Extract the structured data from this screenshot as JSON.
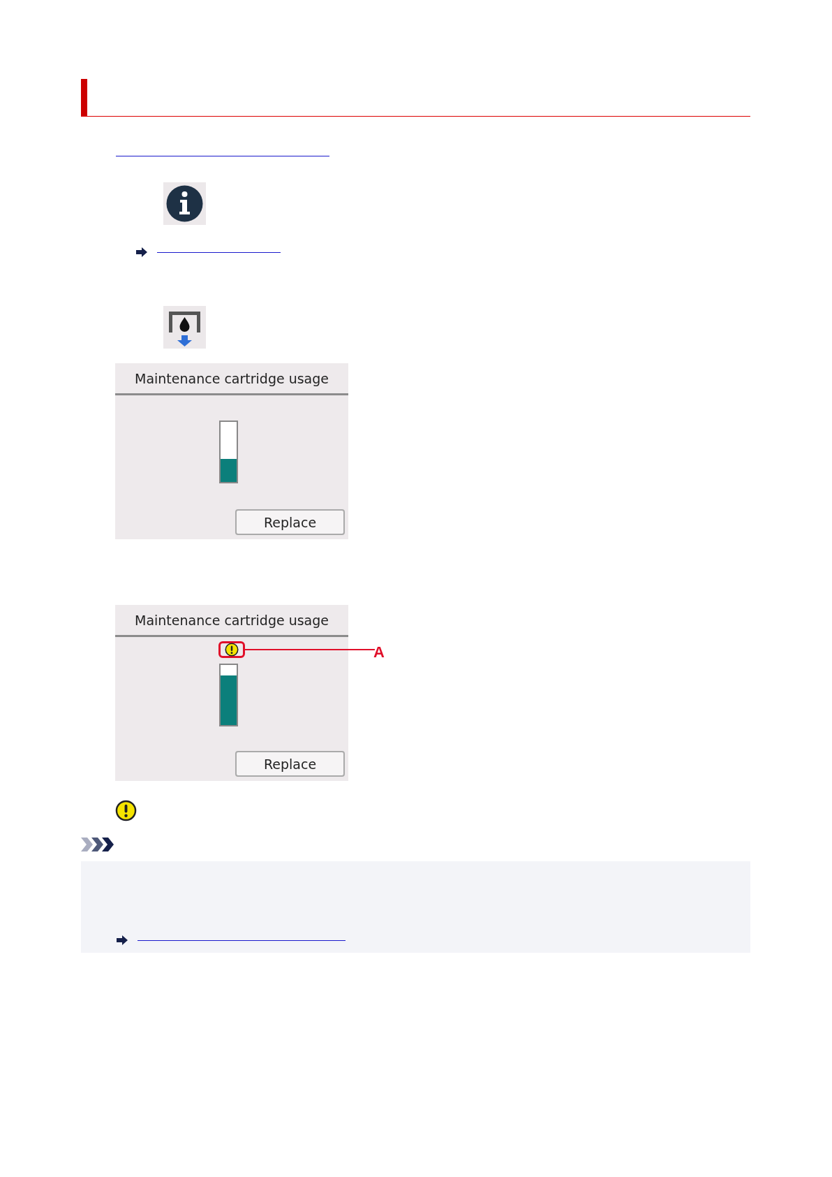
{
  "panels": [
    {
      "title": "Maintenance cartridge usage",
      "level": 0.38,
      "warning": false,
      "button": "Replace"
    },
    {
      "title": "Maintenance cartridge usage",
      "level": 0.83,
      "warning": true,
      "button": "Replace",
      "callout": "A"
    }
  ]
}
